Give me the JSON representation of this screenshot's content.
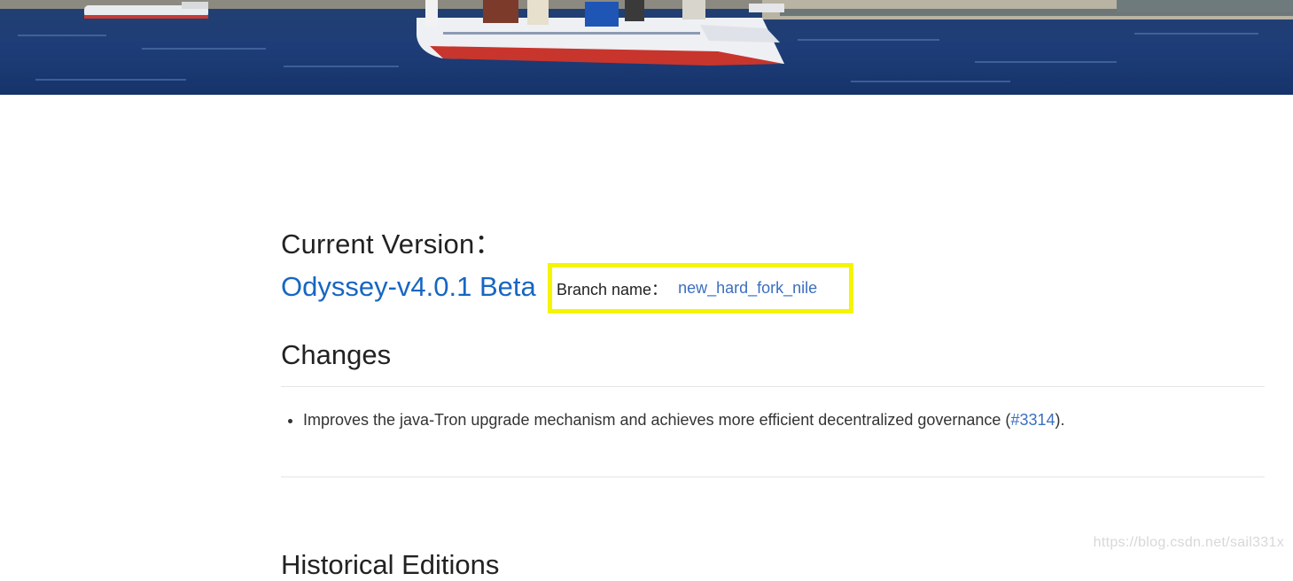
{
  "banner": {
    "icon": "sailboat-photo",
    "colors": {
      "water_top": "#1f3a6c",
      "water_bottom": "#1c3c7a",
      "shore": "#c9c1ae",
      "hull_white": "#eef0f4",
      "hull_red": "#c8352c"
    }
  },
  "current": {
    "heading": "Current Version：",
    "version_link": "Odyssey-v4.0.1 Beta",
    "branch_label": "Branch name：",
    "branch_link": "new_hard_fork_nile",
    "highlight_color": "#f5f500",
    "link_color": "#1766c2"
  },
  "changes": {
    "heading": "Changes",
    "items": [
      {
        "text_before": "Improves the java-Tron upgrade mechanism and achieves more efficient decentralized governance (",
        "link": "#3314",
        "text_after": ")."
      }
    ]
  },
  "historical": {
    "heading": "Historical Editions"
  },
  "watermark": "https://blog.csdn.net/sail331x"
}
